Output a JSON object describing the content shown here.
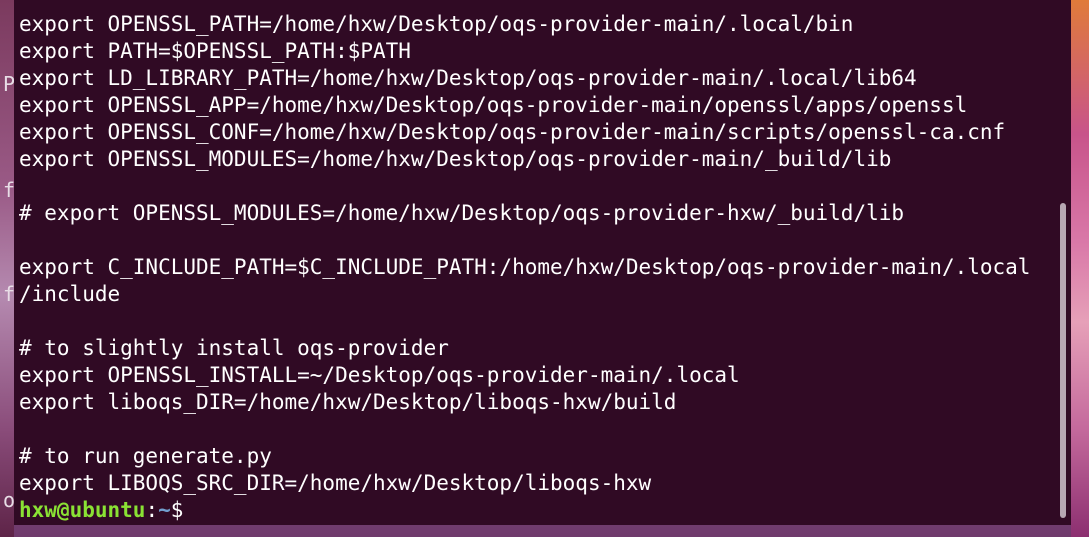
{
  "terminal": {
    "lines": [
      "export OPENSSL_PATH=/home/hxw/Desktop/oqs-provider-main/.local/bin",
      "export PATH=$OPENSSL_PATH:$PATH",
      "export LD_LIBRARY_PATH=/home/hxw/Desktop/oqs-provider-main/.local/lib64",
      "export OPENSSL_APP=/home/hxw/Desktop/oqs-provider-main/openssl/apps/openssl",
      "export OPENSSL_CONF=/home/hxw/Desktop/oqs-provider-main/scripts/openssl-ca.cnf",
      "export OPENSSL_MODULES=/home/hxw/Desktop/oqs-provider-main/_build/lib",
      "",
      "# export OPENSSL_MODULES=/home/hxw/Desktop/oqs-provider-hxw/_build/lib",
      "",
      "export C_INCLUDE_PATH=$C_INCLUDE_PATH:/home/hxw/Desktop/oqs-provider-main/.local",
      "/include",
      "",
      "# to slightly install oqs-provider",
      "export OPENSSL_INSTALL=~/Desktop/oqs-provider-main/.local",
      "export liboqs_DIR=/home/hxw/Desktop/liboqs-hxw/build",
      "",
      "# to run generate.py",
      "export LIBOQS_SRC_DIR=/home/hxw/Desktop/liboqs-hxw"
    ],
    "prompt": {
      "user_host": "hxw@ubuntu",
      "colon": ":",
      "path": "~",
      "sign": "$"
    },
    "colors": {
      "background": "#300a24",
      "text": "#ffffff",
      "prompt_user": "#8ae234",
      "prompt_path": "#729fcf"
    }
  },
  "desktop": {
    "left_fragments": [
      "P",
      "f",
      "f",
      "o"
    ]
  }
}
